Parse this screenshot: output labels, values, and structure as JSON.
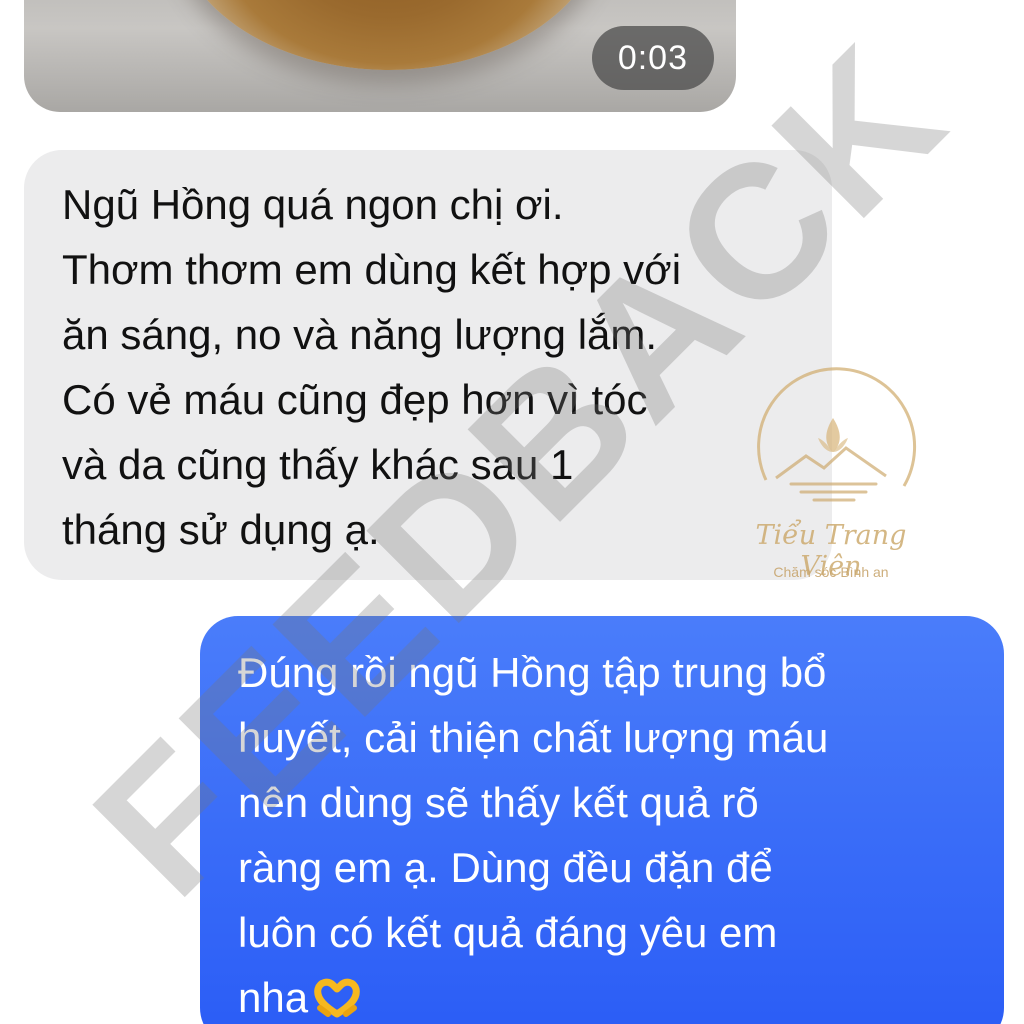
{
  "video_message": {
    "duration": "0:03"
  },
  "messages": [
    {
      "direction": "received",
      "text": "Ngũ Hồng quá ngon chị ơi.\nThơm thơm em dùng kết hợp với\năn sáng, no và năng lượng lắm.\nCó vẻ máu cũng đẹp hơn vì tóc\nvà da cũng thấy khác sau 1\ntháng sử dụng ạ."
    },
    {
      "direction": "sent",
      "text": "Đúng rồi ngũ Hồng tập trung bổ\nhuyết, cải thiện chất lượng máu\nnên dùng sẽ thấy kết quả rõ\nràng em ạ. Dùng đều đặn để\nluôn có kết quả đáng yêu em\nnha",
      "emoji": "heart-hands-emoji"
    }
  ],
  "watermark": {
    "text": "FEEDBACK"
  },
  "logo": {
    "name": "Tiểu Trang Viên",
    "tagline": "Chăm sóc Bình an"
  },
  "colors": {
    "sent_bubble": "#2f62f7",
    "received_bubble": "#ececed",
    "logo_gold": "#cdaa6e"
  }
}
